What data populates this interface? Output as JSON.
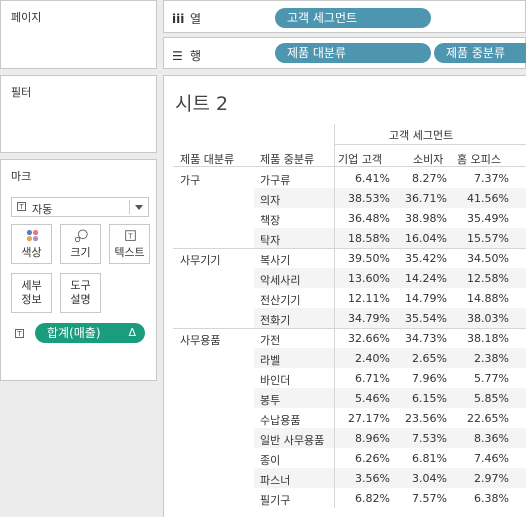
{
  "pages_card": {
    "title": "페이지"
  },
  "filters_card": {
    "title": "필터"
  },
  "marks_card": {
    "title": "마크",
    "mark_type": "자동",
    "buttons": {
      "color": "색상",
      "size": "크기",
      "text": "텍스트",
      "detail": "세부\n정보",
      "tooltip": "도구\n설명"
    },
    "field_pill": "합계(매출)",
    "field_pill_icon": "Δ"
  },
  "shelves": {
    "columns": {
      "label": "열",
      "pills": [
        "고객 세그먼트"
      ]
    },
    "rows": {
      "label": "행",
      "pills": [
        "제품 대분류",
        "제품 중분류"
      ]
    }
  },
  "sheet": {
    "title": "시트 2",
    "column_header_group": "고객 세그먼트",
    "row_header_labels": [
      "제품 대분류",
      "제품 중분류"
    ],
    "column_headers": [
      "기업 고객",
      "소비자",
      "홈 오피스"
    ],
    "groups": [
      {
        "category": "가구",
        "rows": [
          {
            "sub": "가구류",
            "values": [
              "6.41%",
              "8.27%",
              "7.37%"
            ]
          },
          {
            "sub": "의자",
            "values": [
              "38.53%",
              "36.71%",
              "41.56%"
            ]
          },
          {
            "sub": "책장",
            "values": [
              "36.48%",
              "38.98%",
              "35.49%"
            ]
          },
          {
            "sub": "탁자",
            "values": [
              "18.58%",
              "16.04%",
              "15.57%"
            ]
          }
        ]
      },
      {
        "category": "사무기기",
        "rows": [
          {
            "sub": "복사기",
            "values": [
              "39.50%",
              "35.42%",
              "34.50%"
            ]
          },
          {
            "sub": "악세사리",
            "values": [
              "13.60%",
              "14.24%",
              "12.58%"
            ]
          },
          {
            "sub": "전산기기",
            "values": [
              "12.11%",
              "14.79%",
              "14.88%"
            ]
          },
          {
            "sub": "전화기",
            "values": [
              "34.79%",
              "35.54%",
              "38.03%"
            ]
          }
        ]
      },
      {
        "category": "사무용품",
        "rows": [
          {
            "sub": "가전",
            "values": [
              "32.66%",
              "34.73%",
              "38.18%"
            ]
          },
          {
            "sub": "라벨",
            "values": [
              "2.40%",
              "2.65%",
              "2.38%"
            ]
          },
          {
            "sub": "바인더",
            "values": [
              "6.71%",
              "7.96%",
              "5.77%"
            ]
          },
          {
            "sub": "봉투",
            "values": [
              "5.46%",
              "6.15%",
              "5.85%"
            ]
          },
          {
            "sub": "수납용품",
            "values": [
              "27.17%",
              "23.56%",
              "22.65%"
            ]
          },
          {
            "sub": "일반 사무용품",
            "values": [
              "8.96%",
              "7.53%",
              "8.36%"
            ]
          },
          {
            "sub": "종이",
            "values": [
              "6.26%",
              "6.81%",
              "7.46%"
            ]
          },
          {
            "sub": "파스너",
            "values": [
              "3.56%",
              "3.04%",
              "2.97%"
            ]
          },
          {
            "sub": "필기구",
            "values": [
              "6.82%",
              "7.57%",
              "6.38%"
            ]
          }
        ]
      }
    ]
  },
  "colors": {
    "column_pill": "#4e95b0",
    "measure_pill": "#1a9d7c"
  }
}
